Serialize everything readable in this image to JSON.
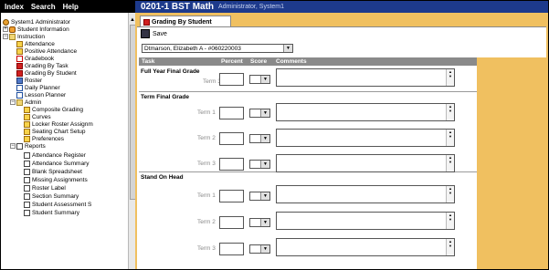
{
  "nav": {
    "index": "Index",
    "search": "Search",
    "help": "Help"
  },
  "header": {
    "title": "0201-1 BST Math",
    "subtitle": "Administrator, System1"
  },
  "sidebar": {
    "items": [
      {
        "label": "System1 Administrator"
      },
      {
        "label": "Student Information"
      },
      {
        "label": "Instruction"
      },
      {
        "label": "Attendance"
      },
      {
        "label": "Positive Attendance"
      },
      {
        "label": "Gradebook"
      },
      {
        "label": "Grading By Task"
      },
      {
        "label": "Grading By Student"
      },
      {
        "label": "Roster"
      },
      {
        "label": "Daily Planner"
      },
      {
        "label": "Lesson Planner"
      },
      {
        "label": "Admin"
      },
      {
        "label": "Composite Grading"
      },
      {
        "label": "Curves"
      },
      {
        "label": "Locker Roster Assignm"
      },
      {
        "label": "Seating Chart Setup"
      },
      {
        "label": "Preferences"
      },
      {
        "label": "Reports"
      },
      {
        "label": "Attendance Register"
      },
      {
        "label": "Attendance Summary"
      },
      {
        "label": "Blank Spreadsheet"
      },
      {
        "label": "Missing Assignments"
      },
      {
        "label": "Roster Label"
      },
      {
        "label": "Section Summary"
      },
      {
        "label": "Student Assessment S"
      },
      {
        "label": "Student Summary"
      }
    ]
  },
  "tab": {
    "label": "Grading By Student"
  },
  "toolbar": {
    "save_label": "Save"
  },
  "student_select": {
    "value": "Dtmarson, Elizabeth A - #060220003"
  },
  "grid": {
    "headers": {
      "task": "Task",
      "percent": "Percent",
      "score": "Score",
      "comments": "Comments"
    },
    "sections": [
      {
        "title": "Full Year Final Grade",
        "terms": [
          "Term 3"
        ]
      },
      {
        "title": "Term Final Grade",
        "terms": [
          "Term 1",
          "Term 2",
          "Term 3"
        ]
      },
      {
        "title": "Stand On Head",
        "terms": [
          "Term 1",
          "Term 2",
          "Term 3"
        ]
      }
    ]
  }
}
